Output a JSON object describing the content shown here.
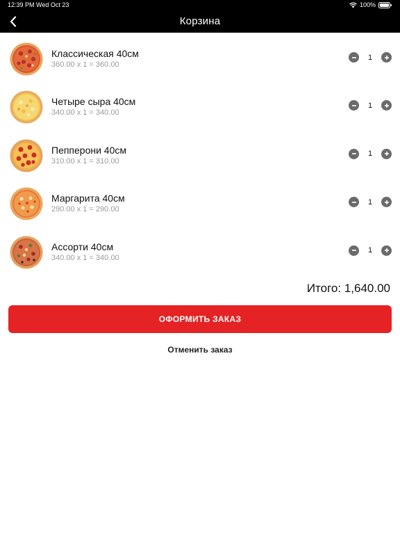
{
  "status_bar": {
    "time": "12:39 PM",
    "date": "Wed Oct 23",
    "battery": "100%"
  },
  "navbar": {
    "title": "Корзина",
    "back_icon": "chevron-left-icon"
  },
  "cart": {
    "items": [
      {
        "name": "Классическая 40см",
        "price_line": "360.00 x 1 = 360.00",
        "quantity": "1",
        "pizza": "classic"
      },
      {
        "name": "Четыре сыра 40см",
        "price_line": "340.00 x 1 = 340.00",
        "quantity": "1",
        "pizza": "four-cheese"
      },
      {
        "name": "Пепперони 40см",
        "price_line": "310.00 x 1 = 310.00",
        "quantity": "1",
        "pizza": "pepperoni"
      },
      {
        "name": "Маргарита 40см",
        "price_line": "290.00 x 1 = 290.00",
        "quantity": "1",
        "pizza": "margherita"
      },
      {
        "name": "Ассорти 40см",
        "price_line": "340.00 x 1 = 340.00",
        "quantity": "1",
        "pizza": "assorti"
      }
    ],
    "total": "Итого: 1,640.00"
  },
  "actions": {
    "checkout_label": "Оформить заказ",
    "cancel_label": "Отменить заказ"
  },
  "colors": {
    "accent": "#e52324",
    "bar": "#000000",
    "qty_button": "#6b6b6b",
    "price_text": "#9a9a9a"
  }
}
